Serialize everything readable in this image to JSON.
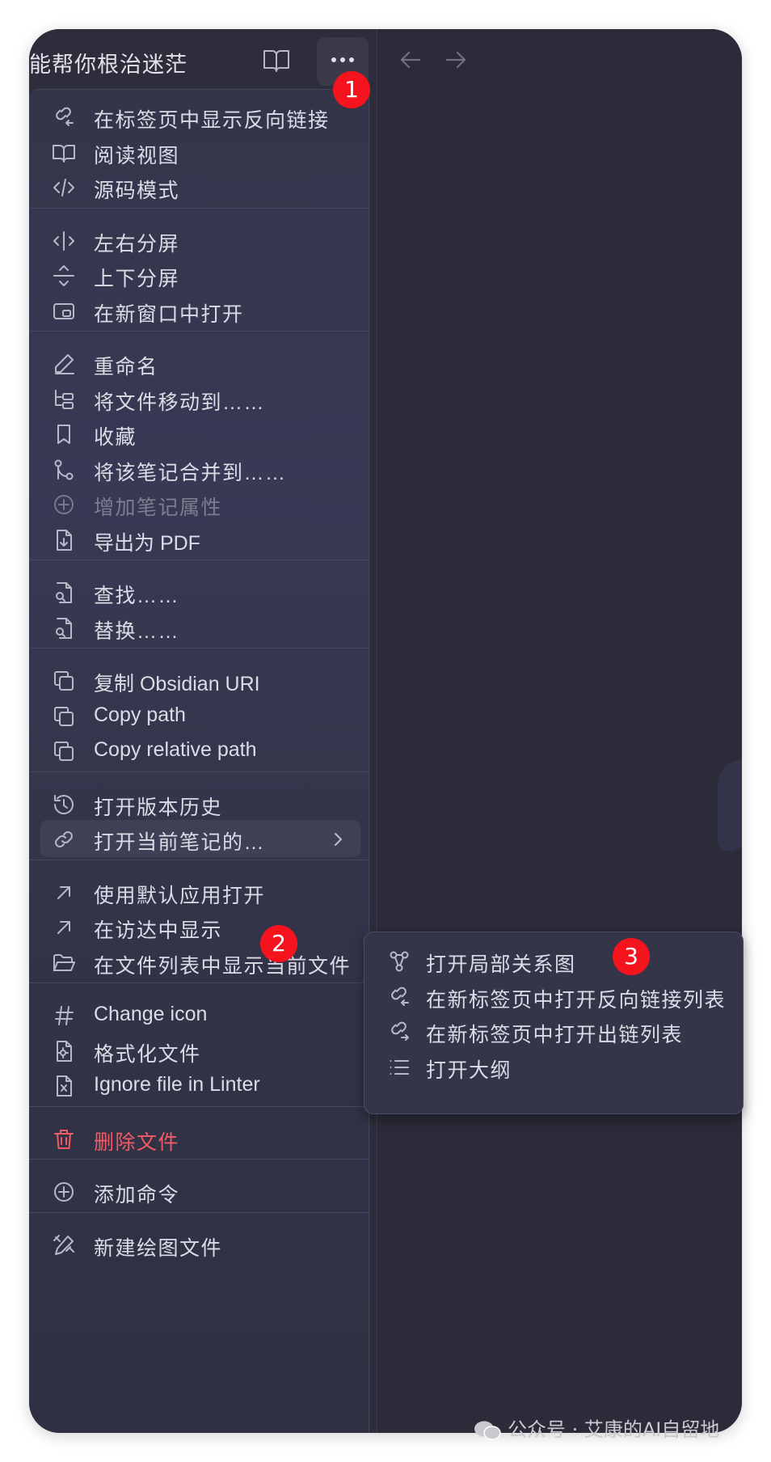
{
  "header": {
    "doc_title": "能帮你根治迷茫",
    "read_view_icon": "book-open-icon",
    "more_icon": "more-horizontal-icon",
    "back_icon": "arrow-left-icon",
    "forward_icon": "arrow-right-icon"
  },
  "menu": {
    "groups": [
      [
        {
          "label": "在标签页中显示反向链接",
          "icon": "link-backlink-icon"
        },
        {
          "label": "阅读视图",
          "icon": "book-open-icon"
        },
        {
          "label": "源码模式",
          "icon": "code-icon"
        }
      ],
      [
        {
          "label": "左右分屏",
          "icon": "split-vertical-icon"
        },
        {
          "label": "上下分屏",
          "icon": "split-horizontal-icon"
        },
        {
          "label": "在新窗口中打开",
          "icon": "window-icon"
        }
      ],
      [
        {
          "label": "重命名",
          "icon": "pencil-icon"
        },
        {
          "label": "将文件移动到……",
          "icon": "folder-tree-icon"
        },
        {
          "label": "收藏",
          "icon": "bookmark-icon"
        },
        {
          "label": "将该笔记合并到……",
          "icon": "git-merge-icon"
        },
        {
          "label": "增加笔记属性",
          "icon": "plus-circle-icon",
          "disabled": true
        },
        {
          "label": "导出为 PDF",
          "icon": "file-download-icon"
        }
      ],
      [
        {
          "label": "查找……",
          "icon": "file-search-icon"
        },
        {
          "label": "替换……",
          "icon": "file-search-icon"
        }
      ],
      [
        {
          "label": "复制 Obsidian URI",
          "icon": "copy-icon"
        },
        {
          "label": "Copy path",
          "icon": "copy-icon"
        },
        {
          "label": "Copy relative path",
          "icon": "copy-icon"
        }
      ],
      [
        {
          "label": "打开版本历史",
          "icon": "history-icon"
        },
        {
          "label": "打开当前笔记的…",
          "icon": "link-icon",
          "submenu": true,
          "hover": true
        }
      ],
      [
        {
          "label": "使用默认应用打开",
          "icon": "arrow-up-right-icon"
        },
        {
          "label": "在访达中显示",
          "icon": "arrow-up-right-icon"
        },
        {
          "label": "在文件列表中显示当前文件",
          "icon": "folder-open-icon"
        }
      ],
      [
        {
          "label": "Change icon",
          "icon": "hash-icon"
        },
        {
          "label": "格式化文件",
          "icon": "file-cog-icon"
        },
        {
          "label": "Ignore file in Linter",
          "icon": "file-x-icon"
        }
      ],
      [
        {
          "label": "删除文件",
          "icon": "trash-icon",
          "danger": true
        }
      ],
      [
        {
          "label": "添加命令",
          "icon": "plus-circle-icon"
        }
      ],
      [
        {
          "label": "新建绘图文件",
          "icon": "pencil-ruler-icon"
        }
      ]
    ]
  },
  "submenu": {
    "items": [
      {
        "label": "打开局部关系图",
        "icon": "graph-icon"
      },
      {
        "label": "在新标签页中打开反向链接列表",
        "icon": "link-backlink-icon"
      },
      {
        "label": "在新标签页中打开出链列表",
        "icon": "link-outgoing-icon"
      },
      {
        "label": "打开大纲",
        "icon": "list-icon"
      }
    ]
  },
  "badges": [
    "1",
    "2",
    "3"
  ],
  "colors": {
    "badge": "#f5141e",
    "danger": "#f15b63",
    "menu_text": "#dcdce6",
    "disabled_text": "#7d7d8e",
    "panel_bg": "#2c2c3a"
  },
  "watermark": {
    "text": "公众号 · 艾康的AI自留地",
    "icon": "wechat-icon"
  }
}
